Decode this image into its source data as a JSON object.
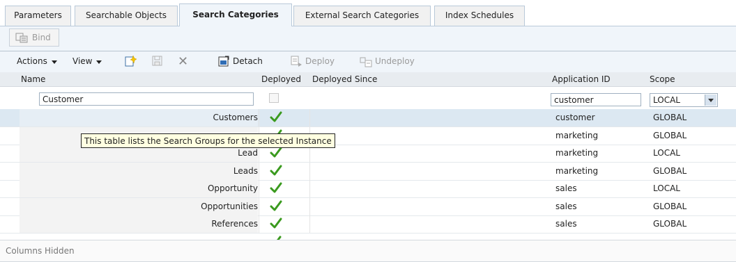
{
  "tabs": [
    {
      "label": "Parameters"
    },
    {
      "label": "Searchable Objects"
    },
    {
      "label": "Search Categories"
    },
    {
      "label": "External Search Categories"
    },
    {
      "label": "Index Schedules"
    }
  ],
  "bind_label": "Bind",
  "toolbar": {
    "actions": "Actions",
    "view": "View",
    "detach": "Detach",
    "deploy": "Deploy",
    "undeploy": "Undeploy"
  },
  "columns": {
    "name": "Name",
    "deployed": "Deployed",
    "deployed_since": "Deployed Since",
    "application_id": "Application ID",
    "scope": "Scope"
  },
  "filter": {
    "name": "Customer",
    "application_id": "customer",
    "scope": "LOCAL"
  },
  "rows": [
    {
      "name": "Customers",
      "application_id": "customer",
      "scope": "GLOBAL"
    },
    {
      "name": "",
      "application_id": "marketing",
      "scope": "GLOBAL"
    },
    {
      "name": "Lead",
      "application_id": "marketing",
      "scope": "LOCAL"
    },
    {
      "name": "Leads",
      "application_id": "marketing",
      "scope": "GLOBAL"
    },
    {
      "name": "Opportunity",
      "application_id": "sales",
      "scope": "LOCAL"
    },
    {
      "name": "Opportunities",
      "application_id": "sales",
      "scope": "GLOBAL"
    },
    {
      "name": "References",
      "application_id": "sales",
      "scope": "GLOBAL"
    }
  ],
  "tooltip": "This table lists the Search Groups for the selected Instance",
  "footer": "Columns Hidden",
  "colors": {
    "check": "#3a9a1e",
    "selected_row": "#dce8f2",
    "toolbar_bg": "#f0f5fa"
  }
}
